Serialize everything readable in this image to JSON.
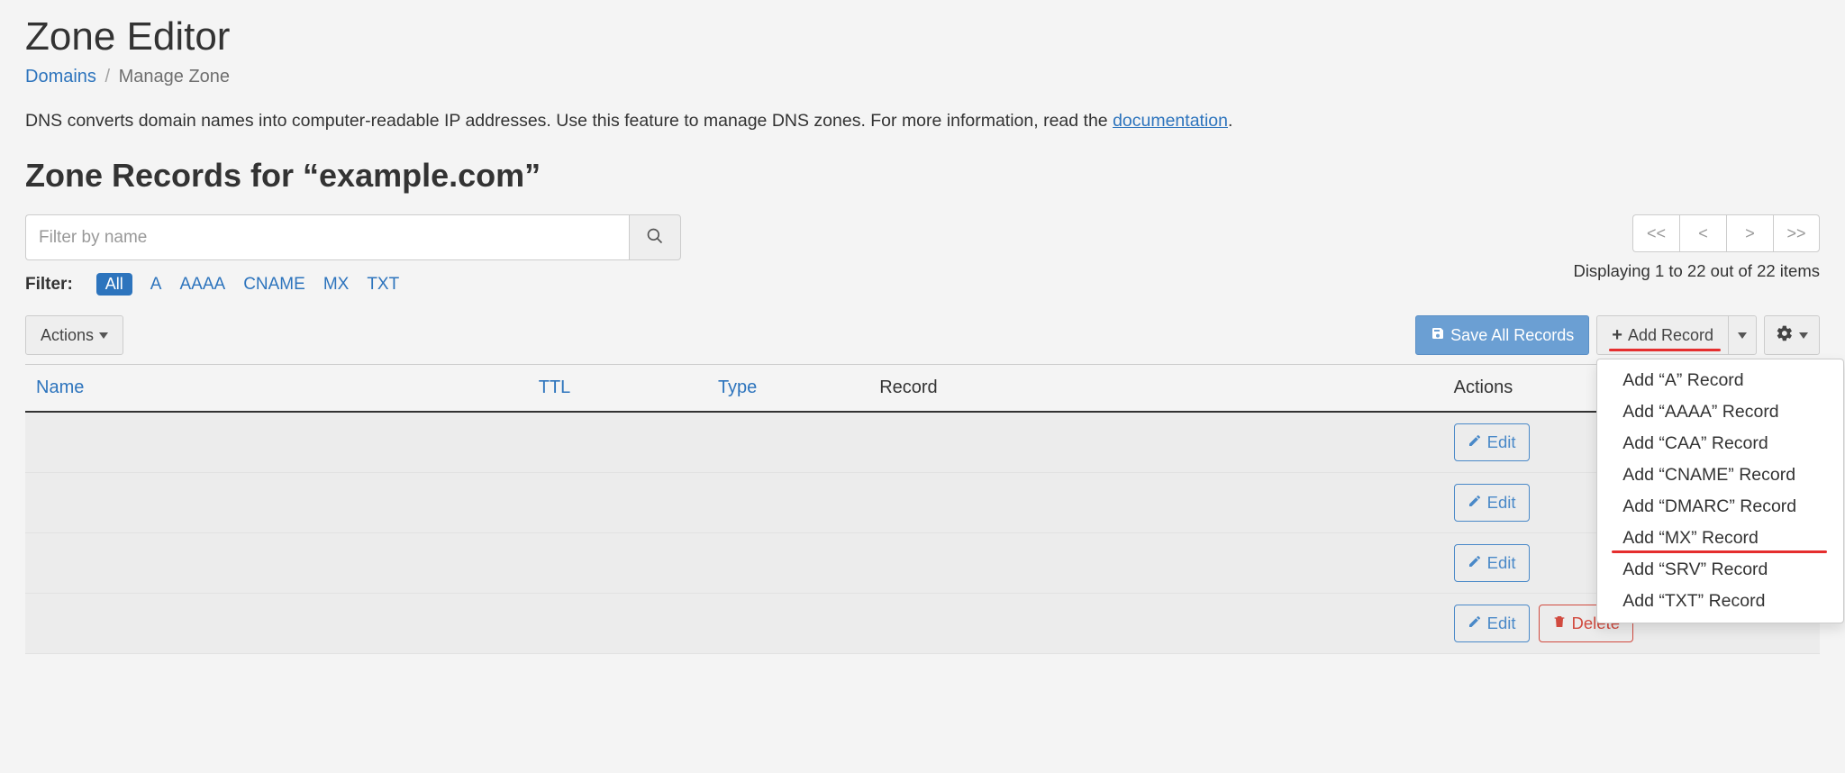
{
  "page": {
    "title": "Zone Editor",
    "breadcrumb_home": "Domains",
    "breadcrumb_current": "Manage Zone",
    "desc_before": "DNS converts domain names into computer-readable IP addresses. Use this feature to manage DNS zones. For more information, read the ",
    "desc_link": "documentation",
    "desc_after": "."
  },
  "records_heading": "Zone Records for “example.com”",
  "search": {
    "placeholder": "Filter by name"
  },
  "filters": {
    "label": "Filter:",
    "all": "All",
    "items": [
      "A",
      "AAAA",
      "CNAME",
      "MX",
      "TXT"
    ]
  },
  "pager": {
    "first": "<<",
    "prev": "<",
    "next": ">",
    "last": ">>"
  },
  "paging_text": "Displaying 1 to 22 out of 22 items",
  "actions_btn": "Actions",
  "save_all": "Save All Records",
  "add_record": "Add Record",
  "add_menu": [
    "Add “A” Record",
    "Add “AAAA” Record",
    "Add “CAA” Record",
    "Add “CNAME” Record",
    "Add “DMARC” Record",
    "Add “MX” Record",
    "Add “SRV” Record",
    "Add “TXT” Record"
  ],
  "add_menu_highlight_index": 5,
  "table": {
    "headers": {
      "name": "Name",
      "ttl": "TTL",
      "type": "Type",
      "record": "Record",
      "actions": "Actions"
    },
    "edit_label": "Edit",
    "delete_label": "Delete",
    "rows": [
      {
        "show_delete": false
      },
      {
        "show_delete": false
      },
      {
        "show_delete": false
      },
      {
        "show_delete": true
      }
    ]
  }
}
